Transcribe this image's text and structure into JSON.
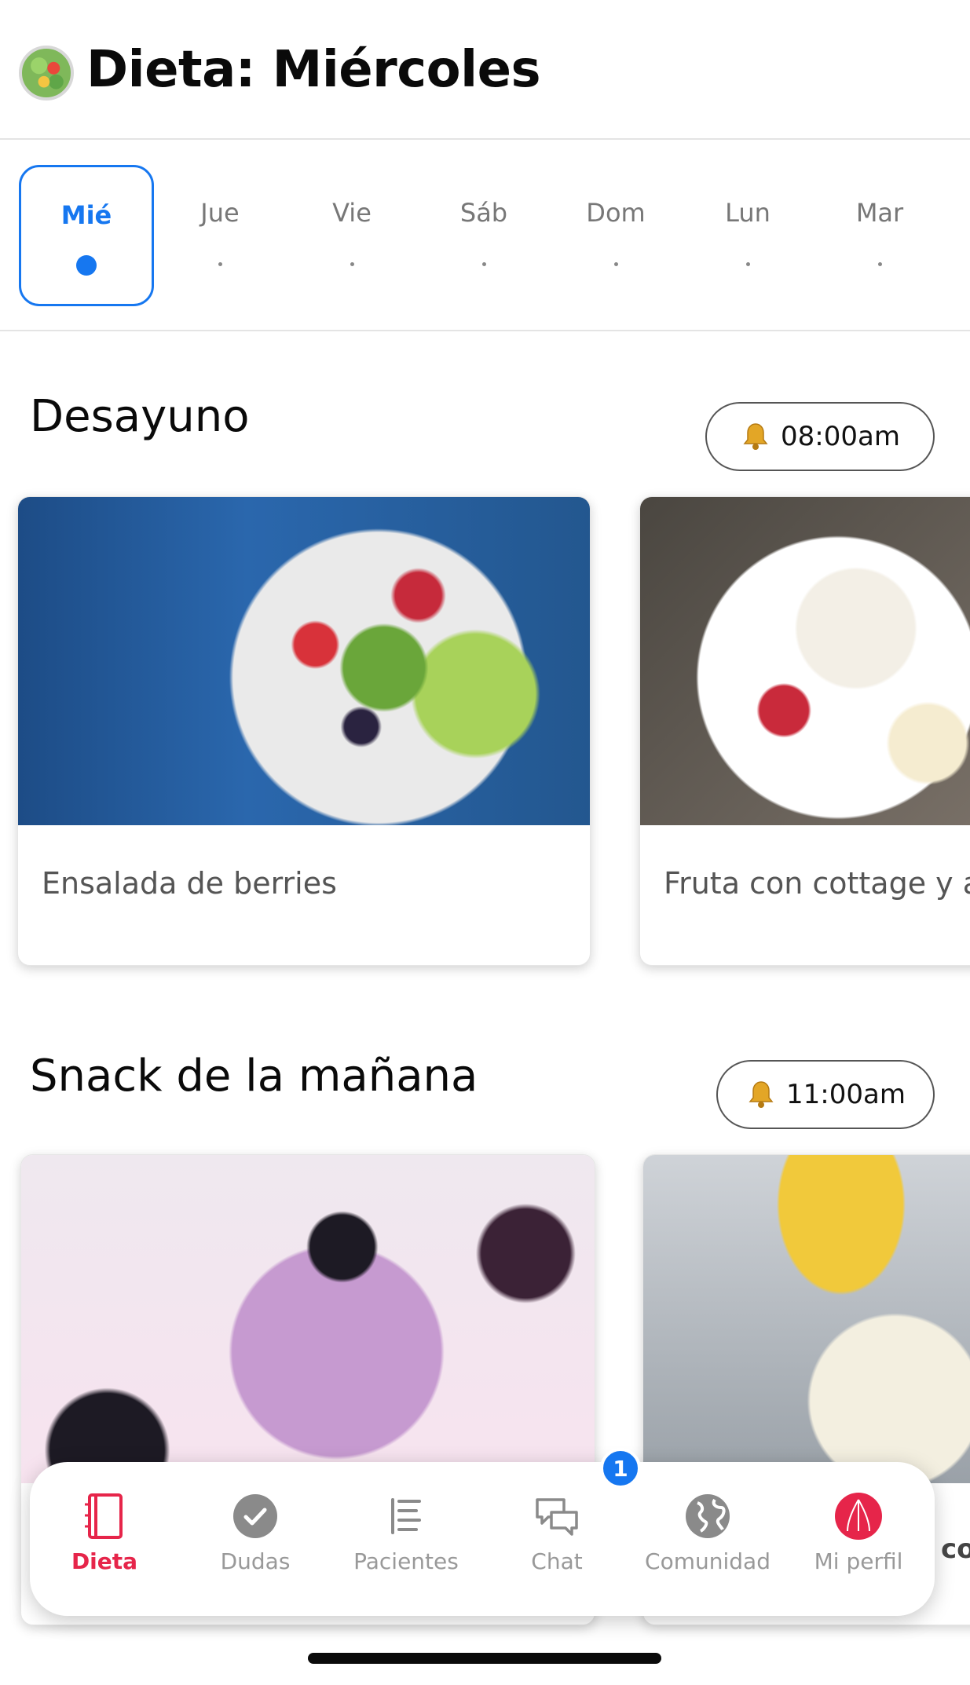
{
  "header": {
    "title": "Dieta: Miércoles"
  },
  "days": [
    {
      "label": "Mié",
      "active": true
    },
    {
      "label": "Jue",
      "active": false
    },
    {
      "label": "Vie",
      "active": false
    },
    {
      "label": "Sáb",
      "active": false
    },
    {
      "label": "Dom",
      "active": false
    },
    {
      "label": "Lun",
      "active": false
    },
    {
      "label": "Mar",
      "active": false
    }
  ],
  "sections": [
    {
      "title": "Desayuno",
      "time": "08:00am",
      "meals": [
        {
          "name": "Ensalada de berries"
        },
        {
          "name": "Fruta con cottage y av"
        }
      ]
    },
    {
      "title": "Snack de la mañana",
      "time": "11:00am",
      "meals": [
        {
          "name": ""
        },
        {
          "name": ""
        }
      ]
    }
  ],
  "bottom_nav": {
    "items": [
      {
        "label": "Dieta",
        "icon": "notebook-icon",
        "active": true
      },
      {
        "label": "Dudas",
        "icon": "check-circle-icon",
        "active": false
      },
      {
        "label": "Pacientes",
        "icon": "list-icon",
        "active": false
      },
      {
        "label": "Chat",
        "icon": "chat-bubbles-icon",
        "active": false,
        "badge": "1"
      },
      {
        "label": "Comunidad",
        "icon": "globe-icon",
        "active": false
      },
      {
        "label": "Mi perfil",
        "icon": "profile-avatar-icon",
        "active": false
      }
    ]
  },
  "peek_text": "co",
  "colors": {
    "accent": "#1677f0",
    "active_nav": "#e6254a"
  }
}
